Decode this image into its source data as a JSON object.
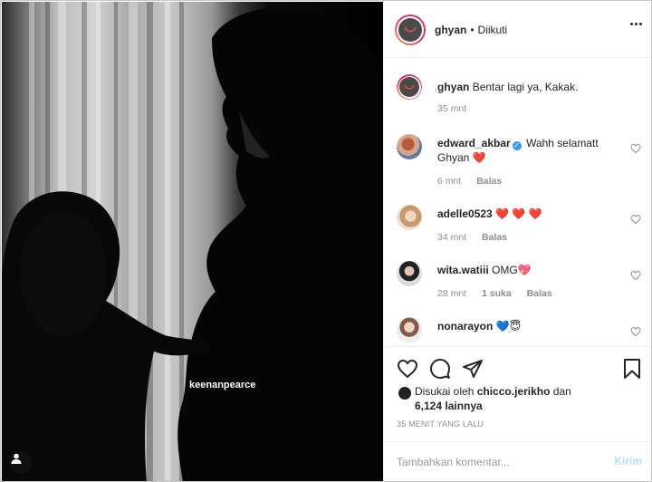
{
  "photo": {
    "tag_label": "keenanpearce",
    "user_tag_icon": "user-silhouette-icon"
  },
  "header": {
    "username": "ghyan",
    "separator": "•",
    "follow_status": "Diikuti",
    "more_icon": "three-dots-icon"
  },
  "caption": {
    "username": "ghyan",
    "text": "Bentar lagi ya, Kakak.",
    "time": "35 mnt"
  },
  "comments": [
    {
      "username": "edward_akbar",
      "verified": true,
      "text": "Wahh selamatt Ghyan ❤️",
      "time": "6 mnt",
      "likes": "",
      "reply": "Balas"
    },
    {
      "username": "adelle0523",
      "verified": false,
      "text": "❤️ ❤️ ❤️",
      "time": "34 mnt",
      "likes": "",
      "reply": "Balas"
    },
    {
      "username": "wita.watiii",
      "verified": false,
      "text": "OMG💖",
      "time": "28 mnt",
      "likes": "1 suka",
      "reply": "Balas"
    },
    {
      "username": "nonarayon",
      "verified": false,
      "text": "💙😇",
      "time": "",
      "likes": "",
      "reply": ""
    }
  ],
  "actions": {
    "like_icon": "heart-icon",
    "comment_icon": "speech-bubble-icon",
    "share_icon": "paper-plane-icon",
    "save_icon": "bookmark-icon"
  },
  "likes": {
    "prefix": "Disukai oleh",
    "user": "chicco.jerikho",
    "connector": "dan",
    "count": "6,124 lainnya"
  },
  "post_time": "35 MENIT YANG LALU",
  "add_comment": {
    "placeholder": "Tambahkan komentar...",
    "send_label": "Kirim"
  },
  "colors": {
    "accent_blue": "#3897f0",
    "send_disabled": "#b2dffc",
    "heart_red": "#ed4956",
    "meta_gray": "#8e8e8e"
  }
}
